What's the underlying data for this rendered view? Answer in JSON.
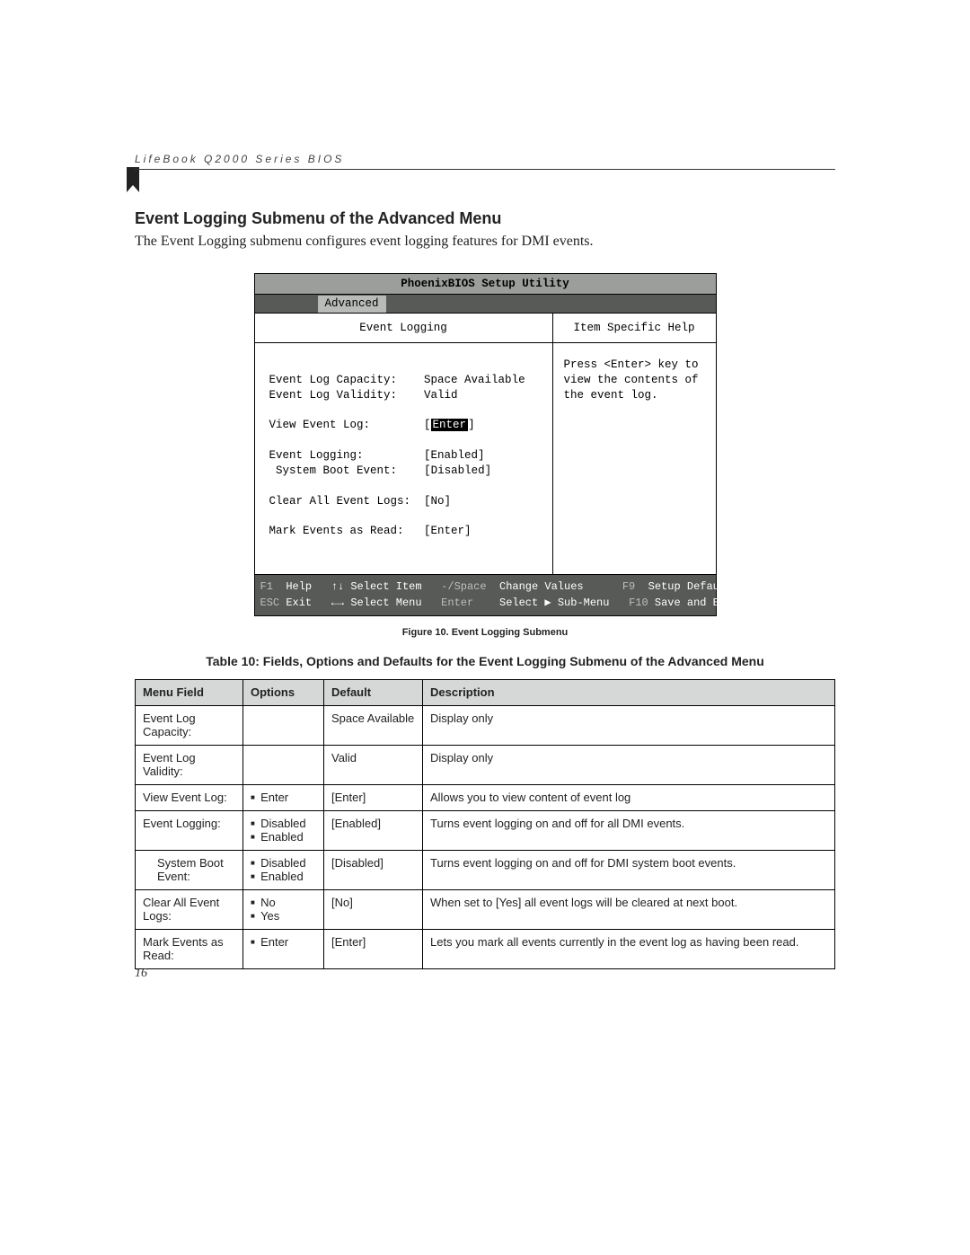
{
  "running_head": "LifeBook Q2000 Series BIOS",
  "section_title": "Event Logging Submenu of the Advanced Menu",
  "intro": "The Event Logging submenu configures event logging features for DMI events.",
  "bios": {
    "title": "PhoenixBIOS Setup Utility",
    "active_tab": "Advanced",
    "left_heading": "Event Logging",
    "right_heading": "Item Specific Help",
    "fields": {
      "capacity_label": "Event Log Capacity:",
      "capacity_value": "Space Available",
      "validity_label": "Event Log Validity:",
      "validity_value": "Valid",
      "view_label": "View Event Log:",
      "view_value": "Enter",
      "logging_label": "Event Logging:",
      "logging_value": "[Enabled]",
      "boot_label": "System Boot Event:",
      "boot_value": "[Disabled]",
      "clear_label": "Clear All Event Logs:",
      "clear_value": "[No]",
      "mark_label": "Mark Events as Read:",
      "mark_value": "[Enter]"
    },
    "help_text": "Press <Enter> key to view the contents of the event log.",
    "footer": {
      "line1": {
        "f1": "F1",
        "l1": "Help",
        "nav1": "↑↓ Select Item",
        "key1": "-/Space",
        "act1": "Change Values",
        "f9": "F9",
        "act2": "Setup Defaults"
      },
      "line2": {
        "esc": "ESC",
        "l2": "Exit",
        "nav2": "←→ Select Menu",
        "key2": "Enter",
        "act3": "Select ▶ Sub-Menu",
        "f10": "F10",
        "act4": "Save and Exit"
      }
    }
  },
  "figure_caption": "Figure 10.  Event Logging Submenu",
  "table_title": "Table 10: Fields, Options and Defaults for the Event Logging Submenu of the Advanced Menu",
  "table": {
    "head": {
      "c1": "Menu Field",
      "c2": "Options",
      "c3": "Default",
      "c4": "Description"
    },
    "rows": [
      {
        "field": "Event Log Capacity:",
        "opts": [],
        "def": "Space Available",
        "desc": "Display only",
        "indent": false
      },
      {
        "field": "Event Log Validity:",
        "opts": [],
        "def": "Valid",
        "desc": "Display only",
        "indent": false
      },
      {
        "field": "View Event Log:",
        "opts": [
          "Enter"
        ],
        "def": "[Enter]",
        "desc": "Allows you to view content of event log",
        "indent": false
      },
      {
        "field": "Event Logging:",
        "opts": [
          "Disabled",
          "Enabled"
        ],
        "def": "[Enabled]",
        "desc": "Turns event logging on and off for all DMI events.",
        "indent": false
      },
      {
        "field": "System Boot Event:",
        "opts": [
          "Disabled",
          "Enabled"
        ],
        "def": "[Disabled]",
        "desc": "Turns event logging on and off for DMI system boot events.",
        "indent": true
      },
      {
        "field": "Clear All Event Logs:",
        "opts": [
          "No",
          "Yes"
        ],
        "def": "[No]",
        "desc": "When set to [Yes] all event logs will be cleared at next boot.",
        "indent": false
      },
      {
        "field": "Mark Events as Read:",
        "opts": [
          "Enter"
        ],
        "def": "[Enter]",
        "desc": "Lets you mark all events currently in the event log as having been read.",
        "indent": false
      }
    ]
  },
  "page_number": "16"
}
